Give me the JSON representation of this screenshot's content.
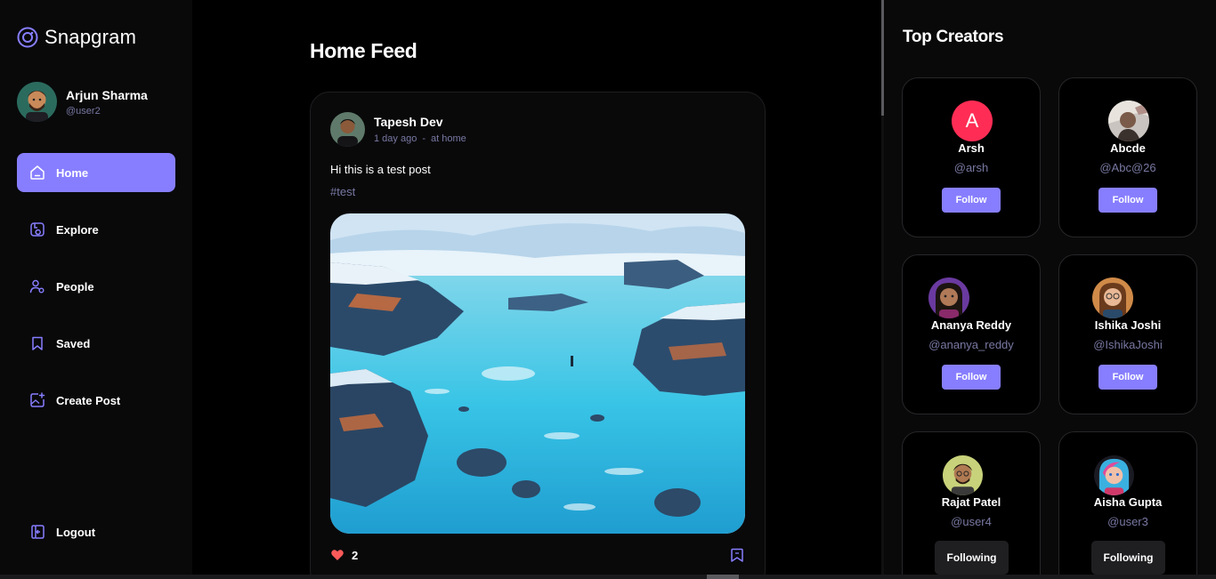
{
  "app": {
    "name": "Snapgram"
  },
  "profile": {
    "name": "Arjun Sharma",
    "handle": "@user2"
  },
  "nav": [
    {
      "label": "Home",
      "icon": "home-icon",
      "active": true
    },
    {
      "label": "Explore",
      "icon": "explore-icon",
      "active": false
    },
    {
      "label": "People",
      "icon": "people-icon",
      "active": false
    },
    {
      "label": "Saved",
      "icon": "bookmark-icon",
      "active": false
    },
    {
      "label": "Create Post",
      "icon": "create-post-icon",
      "active": false
    }
  ],
  "logout_label": "Logout",
  "feed": {
    "title": "Home Feed",
    "post": {
      "author": "Tapesh Dev",
      "time": "1 day ago",
      "separator": "-",
      "location": "at home",
      "caption": "Hi this is a test post",
      "tag": "#test",
      "likes": "2"
    }
  },
  "creators": {
    "title": "Top Creators",
    "items": [
      {
        "name": "Arsh",
        "handle": "@arsh",
        "button": "Follow",
        "avatar_letter": "A"
      },
      {
        "name": "Abcde",
        "handle": "@Abc@26",
        "button": "Follow"
      },
      {
        "name": "Ananya Reddy",
        "handle": "@ananya_reddy",
        "button": "Follow"
      },
      {
        "name": "Ishika Joshi",
        "handle": "@IshikaJoshi",
        "button": "Follow"
      },
      {
        "name": "Rajat Patel",
        "handle": "@user4",
        "button": "Following"
      },
      {
        "name": "Aisha Gupta",
        "handle": "@user3",
        "button": "Following"
      }
    ]
  },
  "colors": {
    "accent": "#877eff",
    "muted": "#7878a3",
    "like": "#ff5a5a",
    "card_bg": "#09090a"
  }
}
